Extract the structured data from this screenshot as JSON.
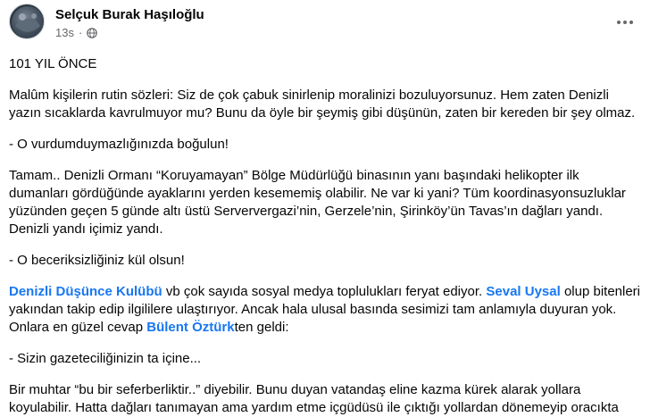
{
  "post": {
    "author": "Selçuk Burak Haşıloğlu",
    "time": "13s",
    "dot": "·",
    "more_icon": "more-horizontal-icon",
    "privacy_icon": "globe-icon"
  },
  "body": {
    "title": "101 YIL ÖNCE",
    "p1_l1": "Malûm kişilerin rutin sözleri: Siz de çok çabuk sinirlenip moralinizi bozuluyorsunuz. Hem zaten Denizli",
    "p1_l2": "yazın sıcaklarda kavrulmuyor mu? Bunu da öyle bir şeymiş gibi düşünün, zaten bir kereden bir şey olmaz.",
    "q1": " - O vurdumduymazlığınızda boğulun!",
    "p2_l1": "Tamam.. Denizli Ormanı “Koruyamayan” Bölge Müdürlüğü binasının yanı başındaki helikopter ilk",
    "p2_l2": "dumanları gördüğünde ayaklarını yerden kesememiş olabilir. Ne var ki yani? Tüm koordinasyonsuzluklar",
    "p2_l3": "yüzünden geçen 5 günde altı üstü Serververgazi’nin, Gerzele’nin, Şirinköy’ün Tavas’ın dağları yandı.",
    "p2_l4": "Denizli yandı içimiz yandı.",
    "q2": " - O beceriksizliğiniz kül olsun!",
    "p3_link1": "Denizli Düşünce Kulübü",
    "p3_t1": " vb çok sayıda sosyal medya toplulukları feryat ediyor. ",
    "p3_link2": "Seval Uysal",
    "p3_t2": " olup bitenleri",
    "p3_l2": "yakından takip edip ilgililere ulaştırıyor. Ancak hala ulusal basında sesimizi tam anlamıyla duyuran yok.",
    "p3_t3": "Onlara en güzel cevap ",
    "p3_link3": "Bülent Öztürk",
    "p3_t4": "ten geldi:",
    "q3": " - Sizin gazeteciliğinizin ta içine...",
    "p4_l1": "Bir muhtar “bu bir seferberliktir..” diyebilir. Bunu duyan vatandaş eline kazma kürek alarak yollara",
    "p4_l2": "koyulabilir. Hatta dağları tanımayan ama yardım etme içgüdüsü ile çıktığı yollardan dönemeyip oracıkta"
  }
}
